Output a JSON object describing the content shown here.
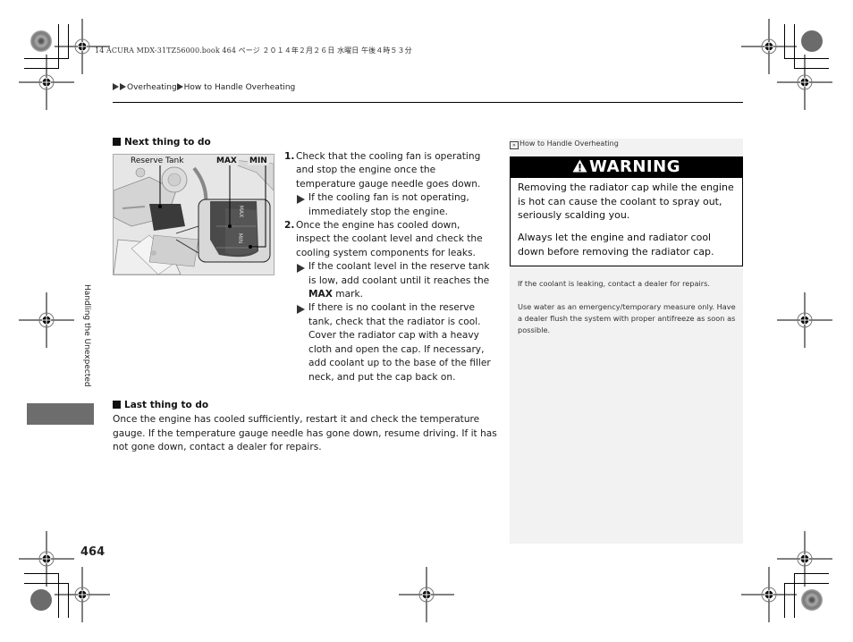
{
  "print_header": "14 ACURA MDX-31TZ56000.book  464 ページ  ２０１４年２月２６日  水曜日  午後４時５３分",
  "breadcrumb": {
    "items": [
      "Overheating",
      "How to Handle Overheating"
    ]
  },
  "side_tab_label": "Handling the Unexpected",
  "page_number": "464",
  "next_section": {
    "heading": "Next thing to do",
    "figure_labels": {
      "reserve_tank": "Reserve Tank",
      "max": "MAX",
      "min": "MIN",
      "tank_max_mark": "MAX",
      "tank_min_mark": "MIN"
    },
    "steps": [
      {
        "number": "1.",
        "text": "Check that the cooling fan is operating and stop the engine once the temperature gauge needle goes down.",
        "subs": [
          {
            "text_before": "If the cooling fan is not operating, immediately stop the engine.",
            "bold": "",
            "text_after": ""
          }
        ]
      },
      {
        "number": "2.",
        "text": "Once the engine has cooled down, inspect the coolant level and check the cooling system components for leaks.",
        "subs": [
          {
            "text_before": "If the coolant level in the reserve tank is low, add coolant until it reaches the ",
            "bold": "MAX",
            "text_after": " mark."
          },
          {
            "text_before": "If there is no coolant in the reserve tank, check that the radiator is cool. Cover the radiator cap with a heavy cloth and open the cap. If necessary, add coolant up to the base of the filler neck, and put the cap back on.",
            "bold": "",
            "text_after": ""
          }
        ]
      }
    ]
  },
  "last_section": {
    "heading": "Last thing to do",
    "body": "Once the engine has cooled sufficiently, restart it and check the temperature gauge. If the temperature gauge needle has gone down, resume driving. If it has not gone down, contact a dealer for repairs."
  },
  "sidebar": {
    "ref_title": "How to Handle Overheating",
    "warning": {
      "title": "WARNING",
      "paragraphs": [
        "Removing the radiator cap while the engine is hot can cause the coolant to spray out, seriously scalding you.",
        "Always let the engine and radiator cool down before removing the radiator cap."
      ]
    },
    "notes": [
      "If the coolant is leaking, contact a dealer for repairs.",
      "Use water as an emergency/temporary measure only. Have a dealer flush the system with proper antifreeze as soon as possible."
    ]
  },
  "colors": {
    "panel_bg": "#f2f2f2",
    "warning_bar": "#000000",
    "side_tab": "#6d6d6d"
  }
}
